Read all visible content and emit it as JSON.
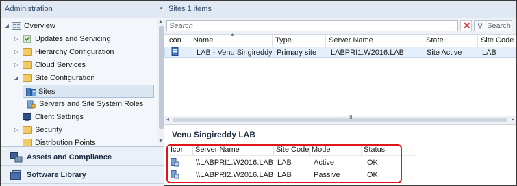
{
  "left_pane": {
    "header_title": "Administration",
    "collapse_glyph": "◂",
    "tree": [
      {
        "label": "Overview",
        "icon": "overview-icon",
        "expanded": true,
        "level": 0
      },
      {
        "label": "Updates and Servicing",
        "icon": "updates-icon",
        "expanded": false,
        "level": 1
      },
      {
        "label": "Hierarchy Configuration",
        "icon": "folder-icon",
        "expanded": false,
        "level": 1
      },
      {
        "label": "Cloud Services",
        "icon": "folder-icon",
        "expanded": false,
        "level": 1
      },
      {
        "label": "Site Configuration",
        "icon": "folder-icon",
        "expanded": true,
        "level": 1
      },
      {
        "label": "Sites",
        "icon": "sites-icon",
        "selected": true,
        "level": 2
      },
      {
        "label": "Servers and Site System Roles",
        "icon": "servers-icon",
        "level": 2
      },
      {
        "label": "Client Settings",
        "icon": "client-settings-icon",
        "level": 1
      },
      {
        "label": "Security",
        "icon": "folder-icon",
        "expanded": false,
        "level": 1
      },
      {
        "label": "Distribution Points",
        "icon": "folder-icon",
        "level": 1
      }
    ],
    "workspaces": [
      {
        "label": "Assets and Compliance",
        "icon": "assets-icon"
      },
      {
        "label": "Software Library",
        "icon": "software-library-icon"
      }
    ]
  },
  "right_pane": {
    "header_title": "Sites 1 items",
    "search": {
      "placeholder": "Search",
      "button_label": "Search"
    },
    "columns": [
      "Icon",
      "Name",
      "Type",
      "Server Name",
      "State",
      "Site Code"
    ],
    "rows": [
      {
        "name": "LAB - Venu Singireddy L...",
        "type": "Primary site",
        "server_name": "LABPRI1.W2016.LAB",
        "state": "Site Active",
        "site_code": "LAB"
      }
    ],
    "hscroll_grip": "III"
  },
  "detail": {
    "title": "Venu Singireddy LAB",
    "columns": [
      "Icon",
      "Server Name",
      "Site Code",
      "Mode",
      "Status"
    ],
    "rows": [
      {
        "server_name": "\\\\LABPRI1.W2016.LAB",
        "site_code": "LAB",
        "mode": "Active",
        "status": "OK"
      },
      {
        "server_name": "\\\\LABPRI2.W2016.LAB",
        "site_code": "LAB",
        "mode": "Passive",
        "status": "OK"
      }
    ],
    "highlight_color": "#e0141b"
  },
  "colors": {
    "header_bg": "#dfe8f3",
    "selection": "#e5effb",
    "folder": "#f2cb64"
  }
}
